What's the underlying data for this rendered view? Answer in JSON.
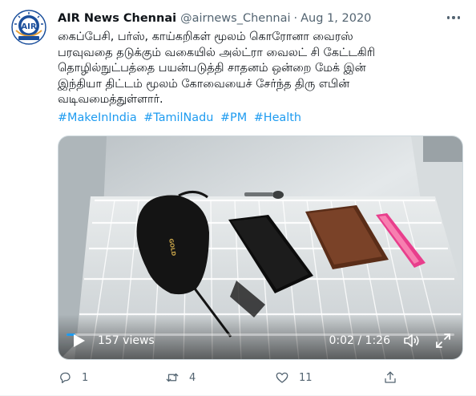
{
  "tweet": {
    "display_name": "AIR News Chennai",
    "handle": "@airnews_Chennai",
    "separator": "·",
    "date": "Aug 1, 2020",
    "text_lines": [
      "கைப்பேசி, பர்ஸ், காய்கறிகள் மூலம் கொரோனா வைரஸ்",
      "பரவுவதை தடுக்கும் வகையில் அல்ட்ரா வைலட் சி கேட்டகிரி",
      "தொழில்நுட்பத்தை பயன்படுத்தி சாதனம் ஒன்றை மேக் இன்",
      "இந்தியா திட்டம் மூலம் கோவையைச் சேர்ந்த திரு எபின்",
      "வடிவமைத்துள்ளார்."
    ],
    "hashtags": [
      "#MakeInIndia",
      "#TamilNadu",
      "#PM",
      "#Health"
    ],
    "avatar_icon": "air-logo-icon"
  },
  "video": {
    "views": "157 views",
    "time": "0:02 / 1:26",
    "progress": 0.023,
    "mask_label": "GOLD"
  },
  "actions": {
    "reply_count": "1",
    "retweet_count": "4",
    "like_count": "11",
    "share_count": ""
  },
  "colors": {
    "accent": "#1d9bf0",
    "text": "#0f1419",
    "secondary": "#536471"
  }
}
